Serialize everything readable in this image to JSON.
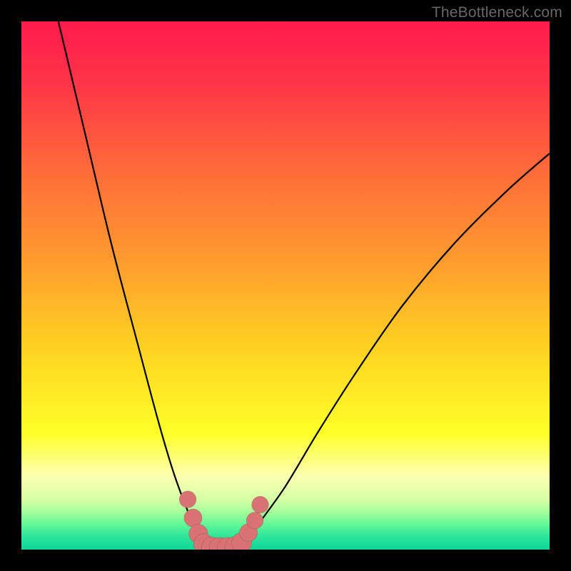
{
  "watermark": "TheBottleneck.com",
  "chart_data": {
    "type": "line",
    "title": "",
    "xlabel": "",
    "ylabel": "",
    "xlim": [
      0,
      100
    ],
    "ylim": [
      0,
      100
    ],
    "background_gradient_stops": [
      {
        "offset": 0.0,
        "color": "#ff1a4c"
      },
      {
        "offset": 0.12,
        "color": "#ff3547"
      },
      {
        "offset": 0.28,
        "color": "#ff6a3a"
      },
      {
        "offset": 0.45,
        "color": "#ff9a2e"
      },
      {
        "offset": 0.62,
        "color": "#ffd321"
      },
      {
        "offset": 0.78,
        "color": "#ffff28"
      },
      {
        "offset": 0.86,
        "color": "#fdffb0"
      },
      {
        "offset": 0.905,
        "color": "#d6ffa8"
      },
      {
        "offset": 0.93,
        "color": "#a2ff9a"
      },
      {
        "offset": 0.955,
        "color": "#5cf598"
      },
      {
        "offset": 0.975,
        "color": "#2de59a"
      },
      {
        "offset": 1.0,
        "color": "#0fd69a"
      }
    ],
    "series": [
      {
        "name": "bottleneck-curve-left",
        "x": [
          7,
          12,
          17,
          22,
          26,
          29,
          32,
          34.5
        ],
        "values": [
          100,
          79,
          58,
          39,
          24,
          14,
          6,
          0
        ]
      },
      {
        "name": "bottleneck-curve-right",
        "x": [
          41.5,
          45,
          50,
          56,
          63,
          72,
          82,
          92,
          100
        ],
        "values": [
          0,
          5,
          12,
          22,
          33,
          46,
          58,
          68,
          75
        ]
      }
    ],
    "markers": {
      "name": "bottleneck-region",
      "points": [
        {
          "x": 31.5,
          "y": 9.5,
          "r": 1.6
        },
        {
          "x": 32.5,
          "y": 6.0,
          "r": 1.7
        },
        {
          "x": 33.5,
          "y": 3.0,
          "r": 1.8
        },
        {
          "x": 34.5,
          "y": 1.1,
          "r": 1.9
        },
        {
          "x": 36.0,
          "y": 0.5,
          "r": 1.9
        },
        {
          "x": 37.5,
          "y": 0.4,
          "r": 1.9
        },
        {
          "x": 39.0,
          "y": 0.4,
          "r": 1.9
        },
        {
          "x": 40.5,
          "y": 0.6,
          "r": 1.9
        },
        {
          "x": 41.7,
          "y": 1.3,
          "r": 1.9
        },
        {
          "x": 43.0,
          "y": 3.2,
          "r": 1.7
        },
        {
          "x": 44.2,
          "y": 5.5,
          "r": 1.6
        },
        {
          "x": 45.2,
          "y": 8.5,
          "r": 1.6
        }
      ]
    }
  }
}
